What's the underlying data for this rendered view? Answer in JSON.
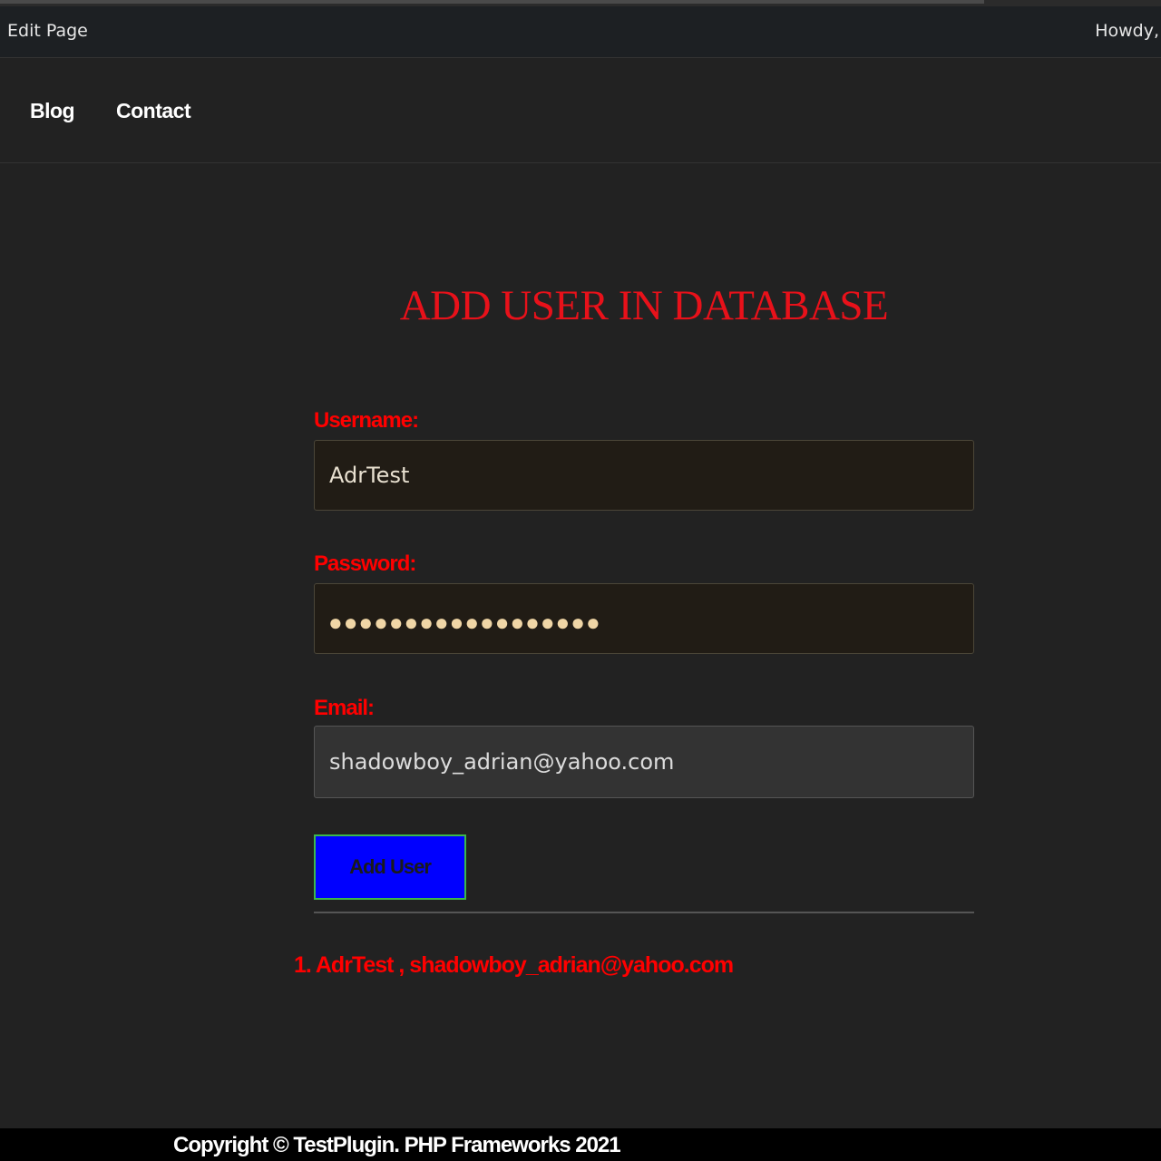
{
  "admin_bar": {
    "edit_page_label": "Edit Page",
    "greeting": "Howdy,"
  },
  "nav": {
    "items": [
      {
        "label": "Blog"
      },
      {
        "label": "Contact"
      }
    ]
  },
  "main": {
    "title": "ADD USER IN DATABASE",
    "form": {
      "username_label": "Username:",
      "username_value": "AdrTest",
      "password_label": "Password:",
      "password_dots": "●●●●●●●●●●●●●●●●●●",
      "email_label": "Email:",
      "email_value": "shadowboy_adrian@yahoo.com",
      "submit_label": "Add User"
    },
    "users": [
      {
        "text": "1. AdrTest , shadowboy_adrian@yahoo.com"
      }
    ]
  },
  "footer": {
    "copyright": "Copyright © TestPlugin. PHP Frameworks 2021"
  },
  "colors": {
    "accent_red": "#ff0000",
    "button_blue": "#0000ff",
    "background": "#222222"
  }
}
